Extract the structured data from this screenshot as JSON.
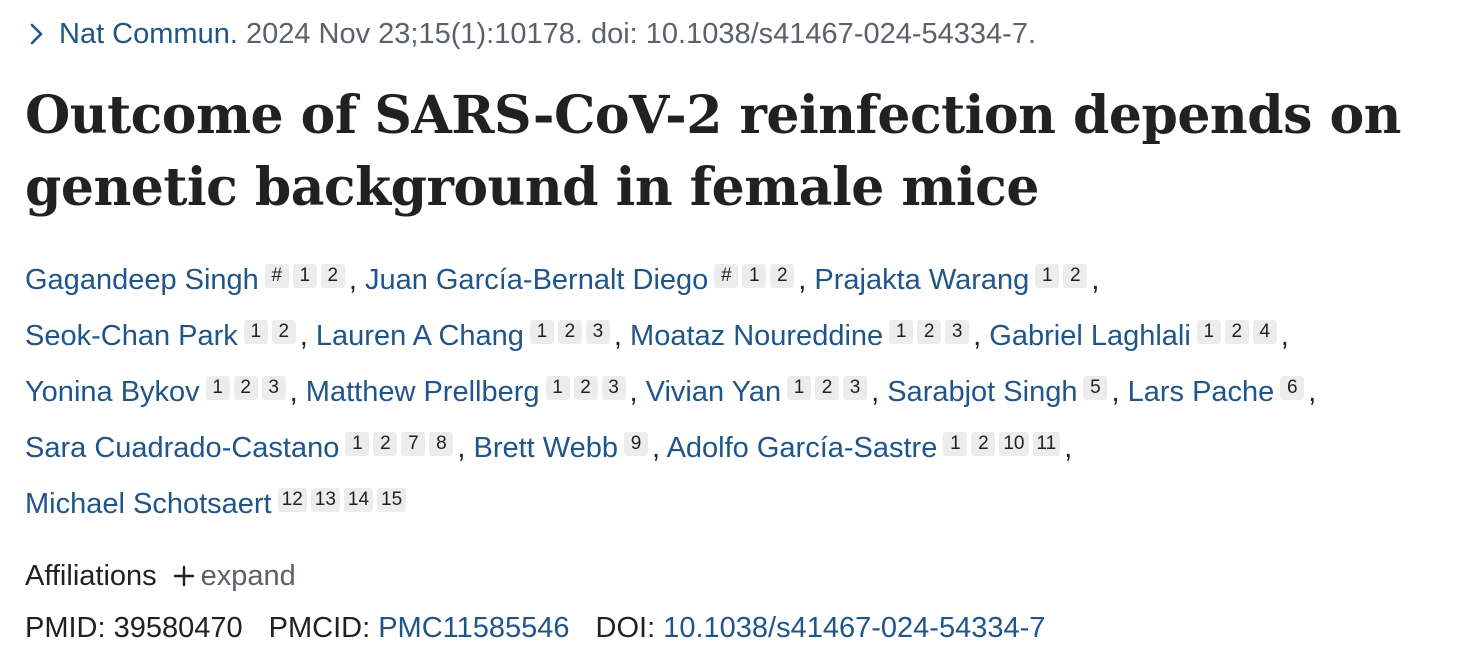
{
  "citation": {
    "journal": "Nat Commun.",
    "details": " 2024 Nov 23;15(1):10178. doi: 10.1038/s41467-024-54334-7."
  },
  "title": "Outcome of SARS-CoV-2 reinfection depends on genetic background in female mice",
  "authors": [
    {
      "name": "Gagandeep Singh",
      "sups": [
        "#",
        "1",
        "2"
      ]
    },
    {
      "name": "Juan García-Bernalt Diego",
      "sups": [
        "#",
        "1",
        "2"
      ]
    },
    {
      "name": "Prajakta Warang",
      "sups": [
        "1",
        "2"
      ]
    },
    {
      "name": "Seok-Chan Park",
      "sups": [
        "1",
        "2"
      ]
    },
    {
      "name": "Lauren A Chang",
      "sups": [
        "1",
        "2",
        "3"
      ]
    },
    {
      "name": "Moataz Noureddine",
      "sups": [
        "1",
        "2",
        "3"
      ]
    },
    {
      "name": "Gabriel Laghlali",
      "sups": [
        "1",
        "2",
        "4"
      ]
    },
    {
      "name": "Yonina Bykov",
      "sups": [
        "1",
        "2",
        "3"
      ]
    },
    {
      "name": "Matthew Prellberg",
      "sups": [
        "1",
        "2",
        "3"
      ]
    },
    {
      "name": "Vivian Yan",
      "sups": [
        "1",
        "2",
        "3"
      ]
    },
    {
      "name": "Sarabjot Singh",
      "sups": [
        "5"
      ]
    },
    {
      "name": "Lars Pache",
      "sups": [
        "6"
      ]
    },
    {
      "name": "Sara Cuadrado-Castano",
      "sups": [
        "1",
        "2",
        "7",
        "8"
      ]
    },
    {
      "name": "Brett Webb",
      "sups": [
        "9"
      ]
    },
    {
      "name": "Adolfo García-Sastre",
      "sups": [
        "1",
        "2",
        "10",
        "11"
      ]
    },
    {
      "name": "Michael Schotsaert",
      "sups": [
        "12",
        "13",
        "14",
        "15"
      ]
    }
  ],
  "line_breaks_after": [
    2,
    6,
    11,
    14
  ],
  "affiliations": {
    "label": "Affiliations",
    "expand_label": "expand"
  },
  "ids": {
    "pmid_label": "PMID:",
    "pmid": "39580470",
    "pmcid_label": "PMCID:",
    "pmcid": "PMC11585546",
    "doi_label": "DOI:",
    "doi": "10.1038/s41467-024-54334-7"
  },
  "colors": {
    "link": "#20558a",
    "text": "#212121",
    "muted": "#5b616b",
    "badge_bg": "#ececec"
  },
  "icons": {
    "citation": "chevron-right-icon",
    "expand": "plus-icon"
  }
}
